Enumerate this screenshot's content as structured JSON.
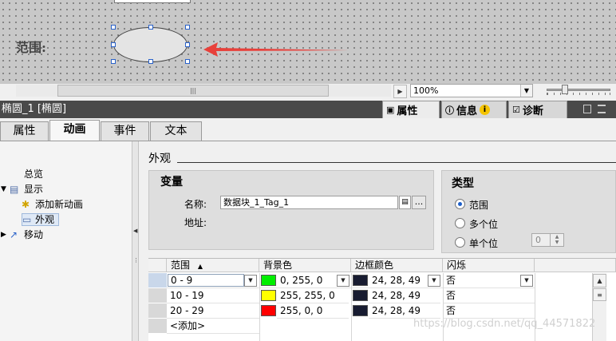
{
  "canvas": {
    "label": "范围:"
  },
  "toolbar": {
    "zoom_value": "100%"
  },
  "object_bar": {
    "title": "椭圆_1 [椭圆]",
    "tabs": [
      {
        "label": "属性",
        "icon": "properties-icon"
      },
      {
        "label": "信息",
        "icon": "info-icon"
      },
      {
        "label": "诊断",
        "icon": "diagnostics-icon"
      }
    ]
  },
  "tabs": [
    {
      "label": "属性"
    },
    {
      "label": "动画"
    },
    {
      "label": "事件"
    },
    {
      "label": "文本"
    }
  ],
  "tree": {
    "items": [
      {
        "label": "总览"
      },
      {
        "label": "显示"
      },
      {
        "label": "添加新动画"
      },
      {
        "label": "外观"
      },
      {
        "label": "移动"
      }
    ]
  },
  "appearance": {
    "section_title": "外观",
    "variable_title": "变量",
    "name_label": "名称:",
    "name_value": "数据块_1_Tag_1",
    "address_label": "地址:",
    "browse_label": "...",
    "type_title": "类型",
    "type_options": [
      {
        "label": "范围",
        "selected": true
      },
      {
        "label": "多个位",
        "selected": false
      },
      {
        "label": "单个位",
        "selected": false
      }
    ],
    "single_bit_value": "0"
  },
  "table": {
    "headers": [
      "范围",
      "背景色",
      "边框颜色",
      "闪烁"
    ],
    "sort_indicator": "▲",
    "rows": [
      {
        "range": "0 - 9",
        "bg_color": "#00ee00",
        "bg_text": "0, 255, 0",
        "border_color": "#181c31",
        "border_text": "24, 28, 49",
        "blink": "否"
      },
      {
        "range": "10 - 19",
        "bg_color": "#ffff00",
        "bg_text": "255, 255, 0",
        "border_color": "#181c31",
        "border_text": "24, 28, 49",
        "blink": "否"
      },
      {
        "range": "20 - 29",
        "bg_color": "#ff0000",
        "bg_text": "255, 0, 0",
        "border_color": "#181c31",
        "border_text": "24, 28, 49",
        "blink": "否"
      }
    ],
    "add_label": "<添加>"
  },
  "watermark": "https://blog.csdn.net/qq_44571822"
}
